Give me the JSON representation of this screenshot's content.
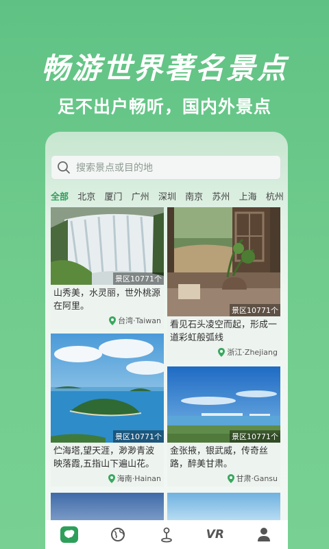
{
  "promo": {
    "headline": "畅游世界著名景点",
    "subline": "足不出户畅听，国内外景点"
  },
  "search": {
    "placeholder": "搜索景点或目的地"
  },
  "cities": [
    "全部",
    "北京",
    "厦门",
    "广州",
    "深圳",
    "南京",
    "苏州",
    "上海",
    "杭州"
  ],
  "active_city": "全部",
  "cards": [
    {
      "count": "景区10771个",
      "desc": "山秀美，水灵丽，世外桃源在阿里。",
      "location": "台湾·Taiwan"
    },
    {
      "count": "景区10771个",
      "desc": "看见石头凌空而起，形成一道彩虹般弧线",
      "location": "浙江·Zhejiang"
    },
    {
      "count": "景区10771个",
      "desc": "伫海塔,望天涯，渺渺青波映落霞,五指山下遍山花。",
      "location": "海南·Hainan"
    },
    {
      "count": "景区10771个",
      "desc": "金张掖，银武威，传奇丝路，醉美甘肃。",
      "location": "甘肃·Gansu"
    }
  ],
  "tabs": [
    {
      "icon": "china-map-icon"
    },
    {
      "icon": "globe-icon"
    },
    {
      "icon": "audio-guide-icon"
    },
    {
      "icon": "vr-icon",
      "text": "VR"
    },
    {
      "icon": "user-icon"
    }
  ],
  "colors": {
    "accent": "#2e9f5a",
    "background": "#6fcb8c"
  }
}
